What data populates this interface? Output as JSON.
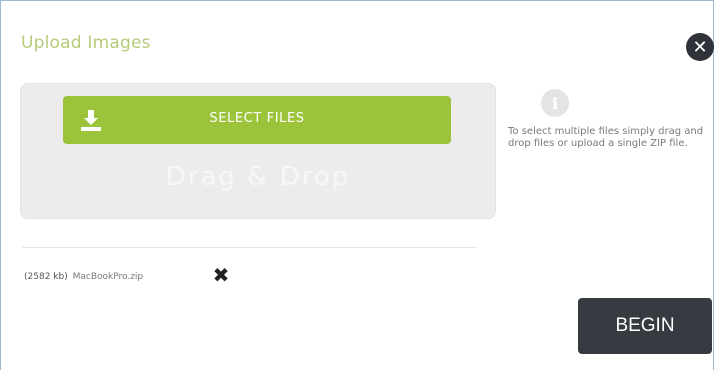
{
  "dialog": {
    "title": "Upload Images",
    "close_icon": "close-icon",
    "close_label": "✕"
  },
  "dropzone": {
    "select_files_label": "SELECT FILES",
    "select_icon": "download-icon",
    "drag_drop_text": "Drag & Drop"
  },
  "info": {
    "icon": "info-icon",
    "icon_label": "i",
    "help_text": "To select multiple files simply drag and drop files or upload a single ZIP file."
  },
  "files": [
    {
      "size": "(2582 kb)",
      "name": "MacBookPro.zip",
      "remove_label": "✖"
    }
  ],
  "actions": {
    "begin_label": "BEGIN"
  },
  "colors": {
    "accent": "#9cc43a",
    "title": "#b6cc7a",
    "dark": "#363b42"
  }
}
